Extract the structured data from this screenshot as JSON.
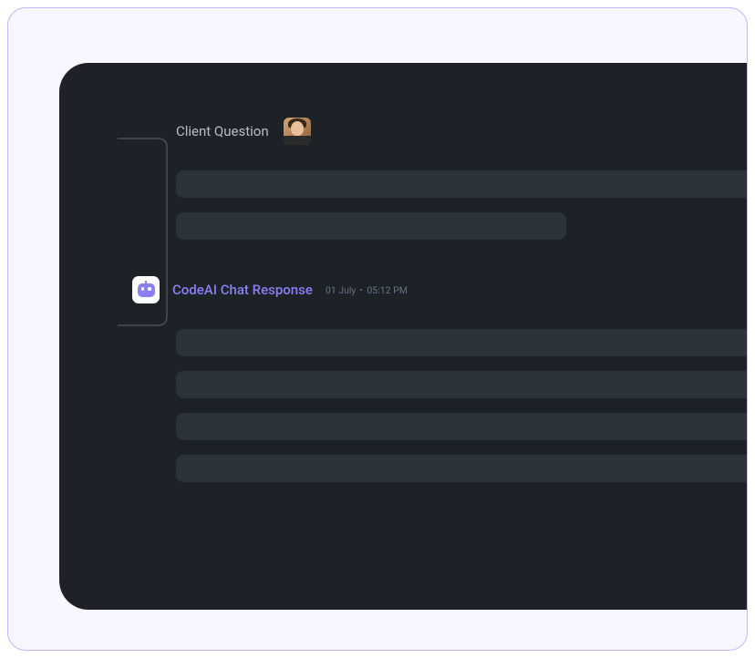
{
  "question": {
    "label": "Client Question"
  },
  "response": {
    "label": "CodeAI Chat Response",
    "date": "01 July",
    "time": "05:12 PM"
  },
  "colors": {
    "accent": "#8b7ff5",
    "background_dark": "#1e2126",
    "placeholder": "#2d3138",
    "border_light": "#c4b5fd"
  }
}
